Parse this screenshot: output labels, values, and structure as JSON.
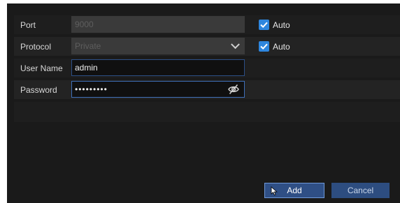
{
  "form": {
    "port": {
      "label": "Port",
      "value": "9000",
      "auto_label": "Auto",
      "auto_checked": true
    },
    "protocol": {
      "label": "Protocol",
      "value": "Private",
      "auto_label": "Auto",
      "auto_checked": true
    },
    "username": {
      "label": "User Name",
      "value": "admin"
    },
    "password": {
      "label": "Password",
      "value": "•••••••••"
    }
  },
  "buttons": {
    "add": "Add",
    "cancel": "Cancel"
  },
  "colors": {
    "accent": "#2e86de",
    "panel": "#1a1a1a",
    "button": "#2f4f85"
  },
  "icons": {
    "password_toggle": "eye-slash-icon",
    "checkbox": "check-icon",
    "dropdown": "chevron-down-icon"
  }
}
